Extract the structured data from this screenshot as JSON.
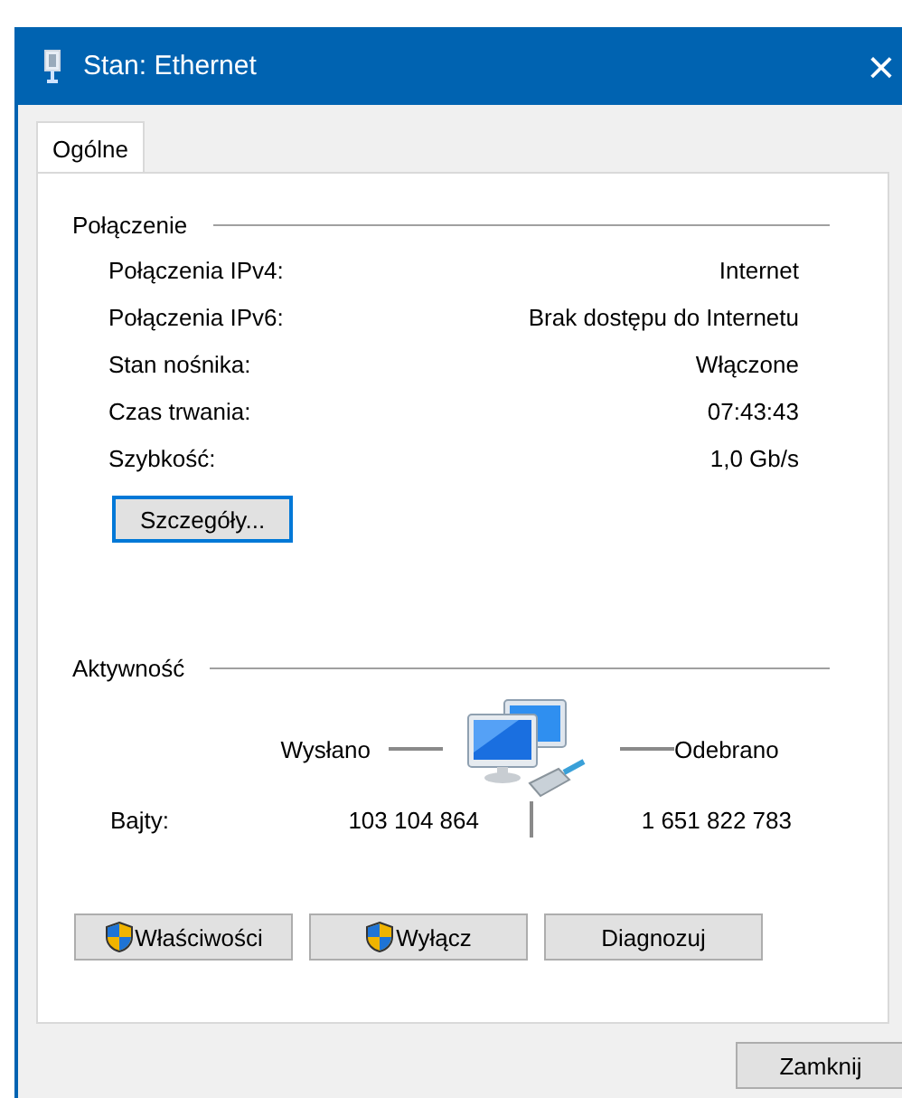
{
  "window": {
    "title": "Stan: Ethernet",
    "close": "×"
  },
  "tabs": [
    {
      "label": "Ogólne",
      "selected": true
    }
  ],
  "connection": {
    "heading": "Połączenie",
    "rows": [
      {
        "label": "Połączenia IPv4:",
        "value": "Internet"
      },
      {
        "label": "Połączenia IPv6:",
        "value": "Brak dostępu do Internetu"
      },
      {
        "label": "Stan nośnika:",
        "value": "Włączone"
      },
      {
        "label": "Czas trwania:",
        "value": "07:43:43"
      },
      {
        "label": "Szybkość:",
        "value": "1,0 Gb/s"
      }
    ],
    "details_button": {
      "label": "Szczegóły...",
      "focused": true
    }
  },
  "activity": {
    "heading": "Aktywność",
    "sent_label": "Wysłano",
    "received_label": "Odebrano",
    "bytes_label": "Bajty:",
    "bytes_sent": "103 104 864",
    "bytes_received": "1 651 822 783"
  },
  "buttons": [
    {
      "label": "Właściwości",
      "kind": "shield"
    },
    {
      "label": "Wyłącz",
      "kind": "shield"
    },
    {
      "label": "Diagnozuj",
      "kind": "plain"
    }
  ],
  "close_button": "Zamknij"
}
